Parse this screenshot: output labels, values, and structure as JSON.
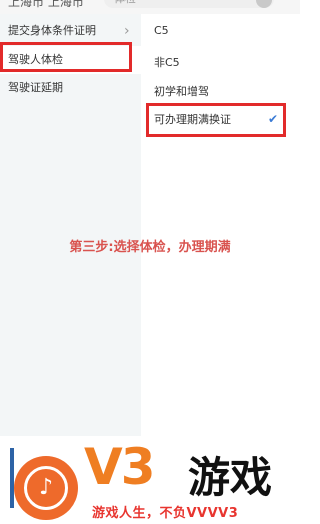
{
  "topbar": {
    "city": "上海市 上海市",
    "search_placeholder": "体检"
  },
  "sidebar": {
    "items": [
      {
        "label": "提交身体条件证明",
        "chevron": "›"
      },
      {
        "label": "驾驶人体检"
      },
      {
        "label": "驾驶证延期"
      }
    ]
  },
  "options": {
    "items": [
      {
        "label": "C5"
      },
      {
        "label": "非C5"
      },
      {
        "label": "初学和增驾"
      },
      {
        "label": "可办理期满换证",
        "selected_mark": "✔"
      }
    ]
  },
  "annotation": {
    "text": "第三步:选择体检，办理期满"
  },
  "brand": {
    "logo_glyph": "♪",
    "v3": "V3",
    "name": "游戏",
    "slogan": "游戏人生，不负VVVV3"
  },
  "colors": {
    "highlight": "#e22a2a",
    "annotation": "#d9534f",
    "brand_orange": "#ef7e22",
    "slogan_red": "#e8352f",
    "check_blue": "#3a7bd5"
  }
}
